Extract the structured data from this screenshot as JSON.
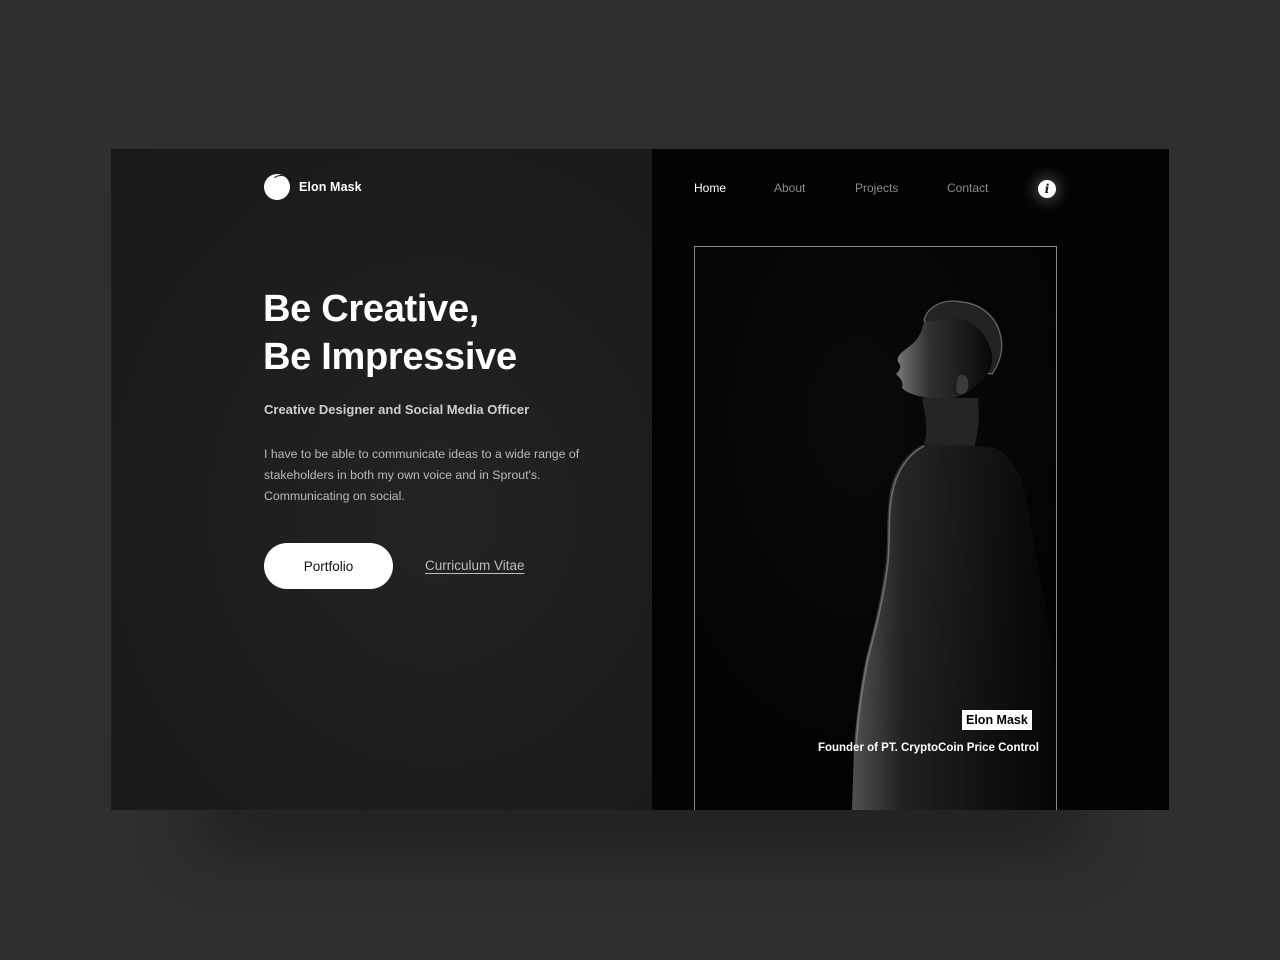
{
  "brand": {
    "name": "Elon Mask",
    "logo_icon": "crescent-circle-icon"
  },
  "nav": {
    "items": [
      {
        "label": "Home",
        "active": true
      },
      {
        "label": "About",
        "active": false
      },
      {
        "label": "Projects",
        "active": false
      },
      {
        "label": "Contact",
        "active": false
      }
    ],
    "info_icon": "info-icon",
    "info_label": "i"
  },
  "hero": {
    "title_line1": "Be Creative,",
    "title_line2": "Be Impressive",
    "subtitle": "Creative Designer and Social Media Officer",
    "description": "I have to be able to communicate ideas to a wide range of stakeholders in both my own voice and in Sprout's. Communicating on social.",
    "primary_button": "Portfolio",
    "secondary_link": "Curriculum Vitae"
  },
  "profile": {
    "name": "Elon Mask",
    "role": "Founder of PT. CryptoCoin Price Control"
  },
  "colors": {
    "page_background": "#2f2f2f",
    "left_panel": "#1c1d1c",
    "right_panel": "#030303",
    "accent": "#ffffff",
    "muted_text": "#8d8d8d"
  }
}
